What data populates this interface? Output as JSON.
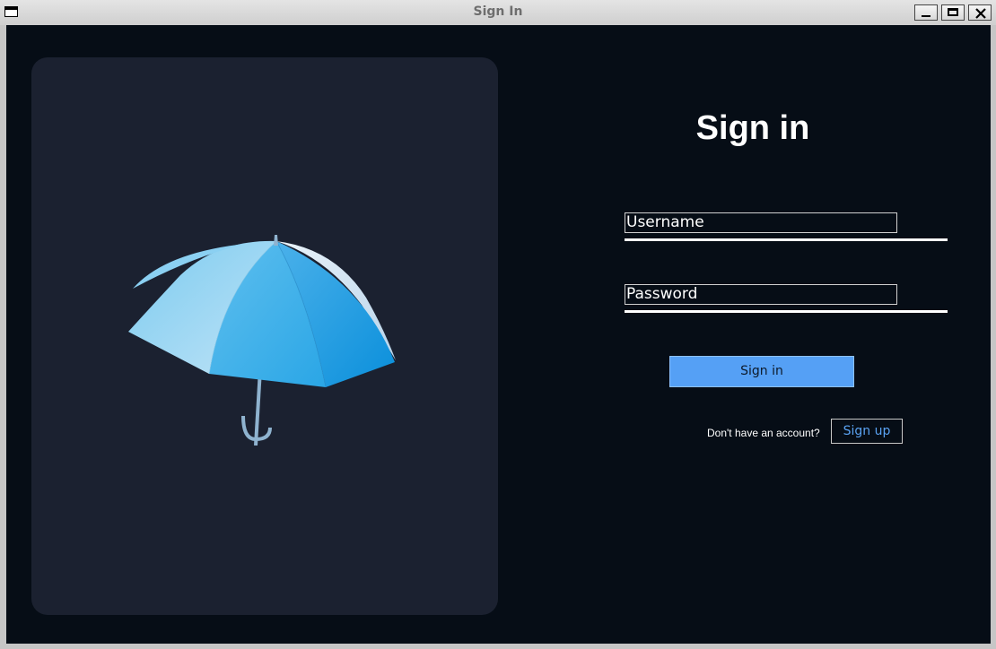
{
  "window": {
    "title": "Sign In"
  },
  "form": {
    "heading": "Sign in",
    "username_placeholder": "Username",
    "password_placeholder": "Password",
    "signin_label": "Sign in",
    "signup_prompt": "Don't have an account?",
    "signup_label": "Sign up"
  },
  "colors": {
    "background": "#060d16",
    "card": "#1b2130",
    "accent": "#55a0f5",
    "link": "#5aa2f2"
  },
  "icons": {
    "hero": "umbrella-illustration"
  }
}
